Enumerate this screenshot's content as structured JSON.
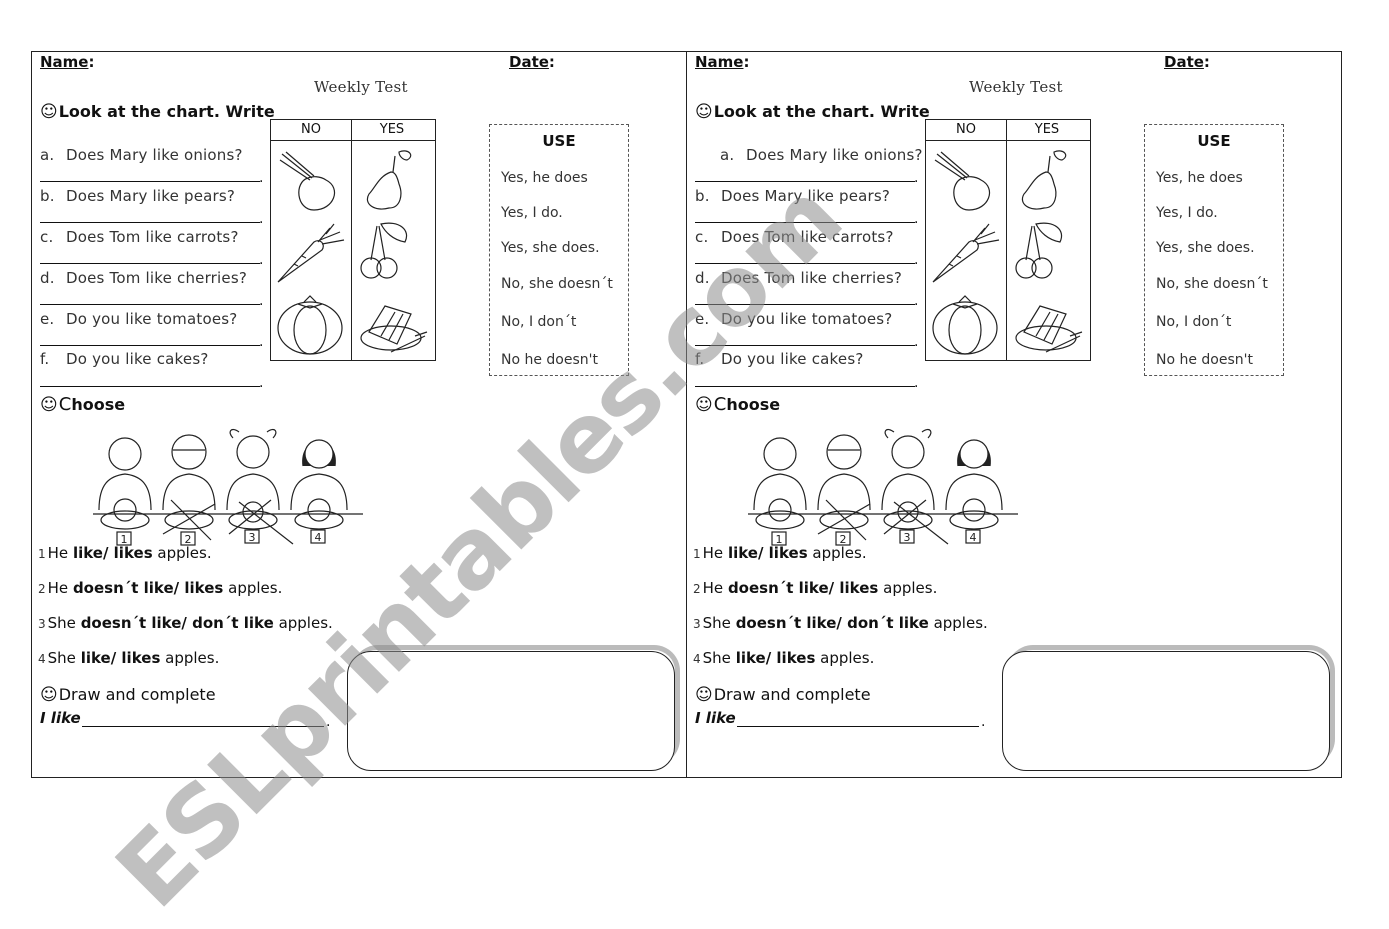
{
  "worksheet": {
    "name_label": "Name",
    "date_label": "Date",
    "colon": ":",
    "title": "Weekly Test",
    "section1": {
      "smile": "☺",
      "label": "Look at the chart. Write"
    },
    "questions": [
      {
        "letter": "a.",
        "text": "Does Mary like onions?"
      },
      {
        "letter": "b.",
        "text": "Does Mary like pears?"
      },
      {
        "letter": "c.",
        "text": "Does Tom like carrots?"
      },
      {
        "letter": "d.",
        "text": "Does Tom like cherries?"
      },
      {
        "letter": "e.",
        "text": "Do you like tomatoes?"
      },
      {
        "letter": "f.",
        "text": "Do you like cakes?"
      }
    ],
    "answer_dot": ".",
    "chart": {
      "headers": [
        "NO",
        "YES"
      ],
      "no_items": [
        "onion",
        "carrot",
        "tomato"
      ],
      "yes_items": [
        "pear",
        "cherries",
        "cake"
      ]
    },
    "use_box": {
      "title": "USE",
      "items": [
        "Yes, he does",
        "Yes, I do.",
        "Yes, she does.",
        "No, she doesn´t",
        "No, I don´t",
        "No he doesn't"
      ]
    },
    "section2": {
      "smile": "☺",
      "cap": "C",
      "label": "hoose"
    },
    "kids": {
      "numbers": [
        "1",
        "2",
        "3",
        "4"
      ],
      "crossed": [
        false,
        true,
        true,
        false
      ]
    },
    "statements": [
      {
        "num": "1",
        "pre": "He",
        "bold": "like/ likes",
        "post": "apples."
      },
      {
        "num": "2",
        "pre": "He",
        "bold": "doesn´t like/ likes",
        "post": "apples."
      },
      {
        "num": "3",
        "pre": "She",
        "bold": "doesn´t like/ don´t like",
        "post": "apples."
      },
      {
        "num": "4",
        "pre": "She",
        "bold": "like/ likes",
        "post": "apples."
      }
    ],
    "section3": {
      "smile": "☺",
      "label": "Draw and complete"
    },
    "ilike": "I like",
    "ilike_dot": "."
  },
  "watermark": "ESLprintables.com"
}
